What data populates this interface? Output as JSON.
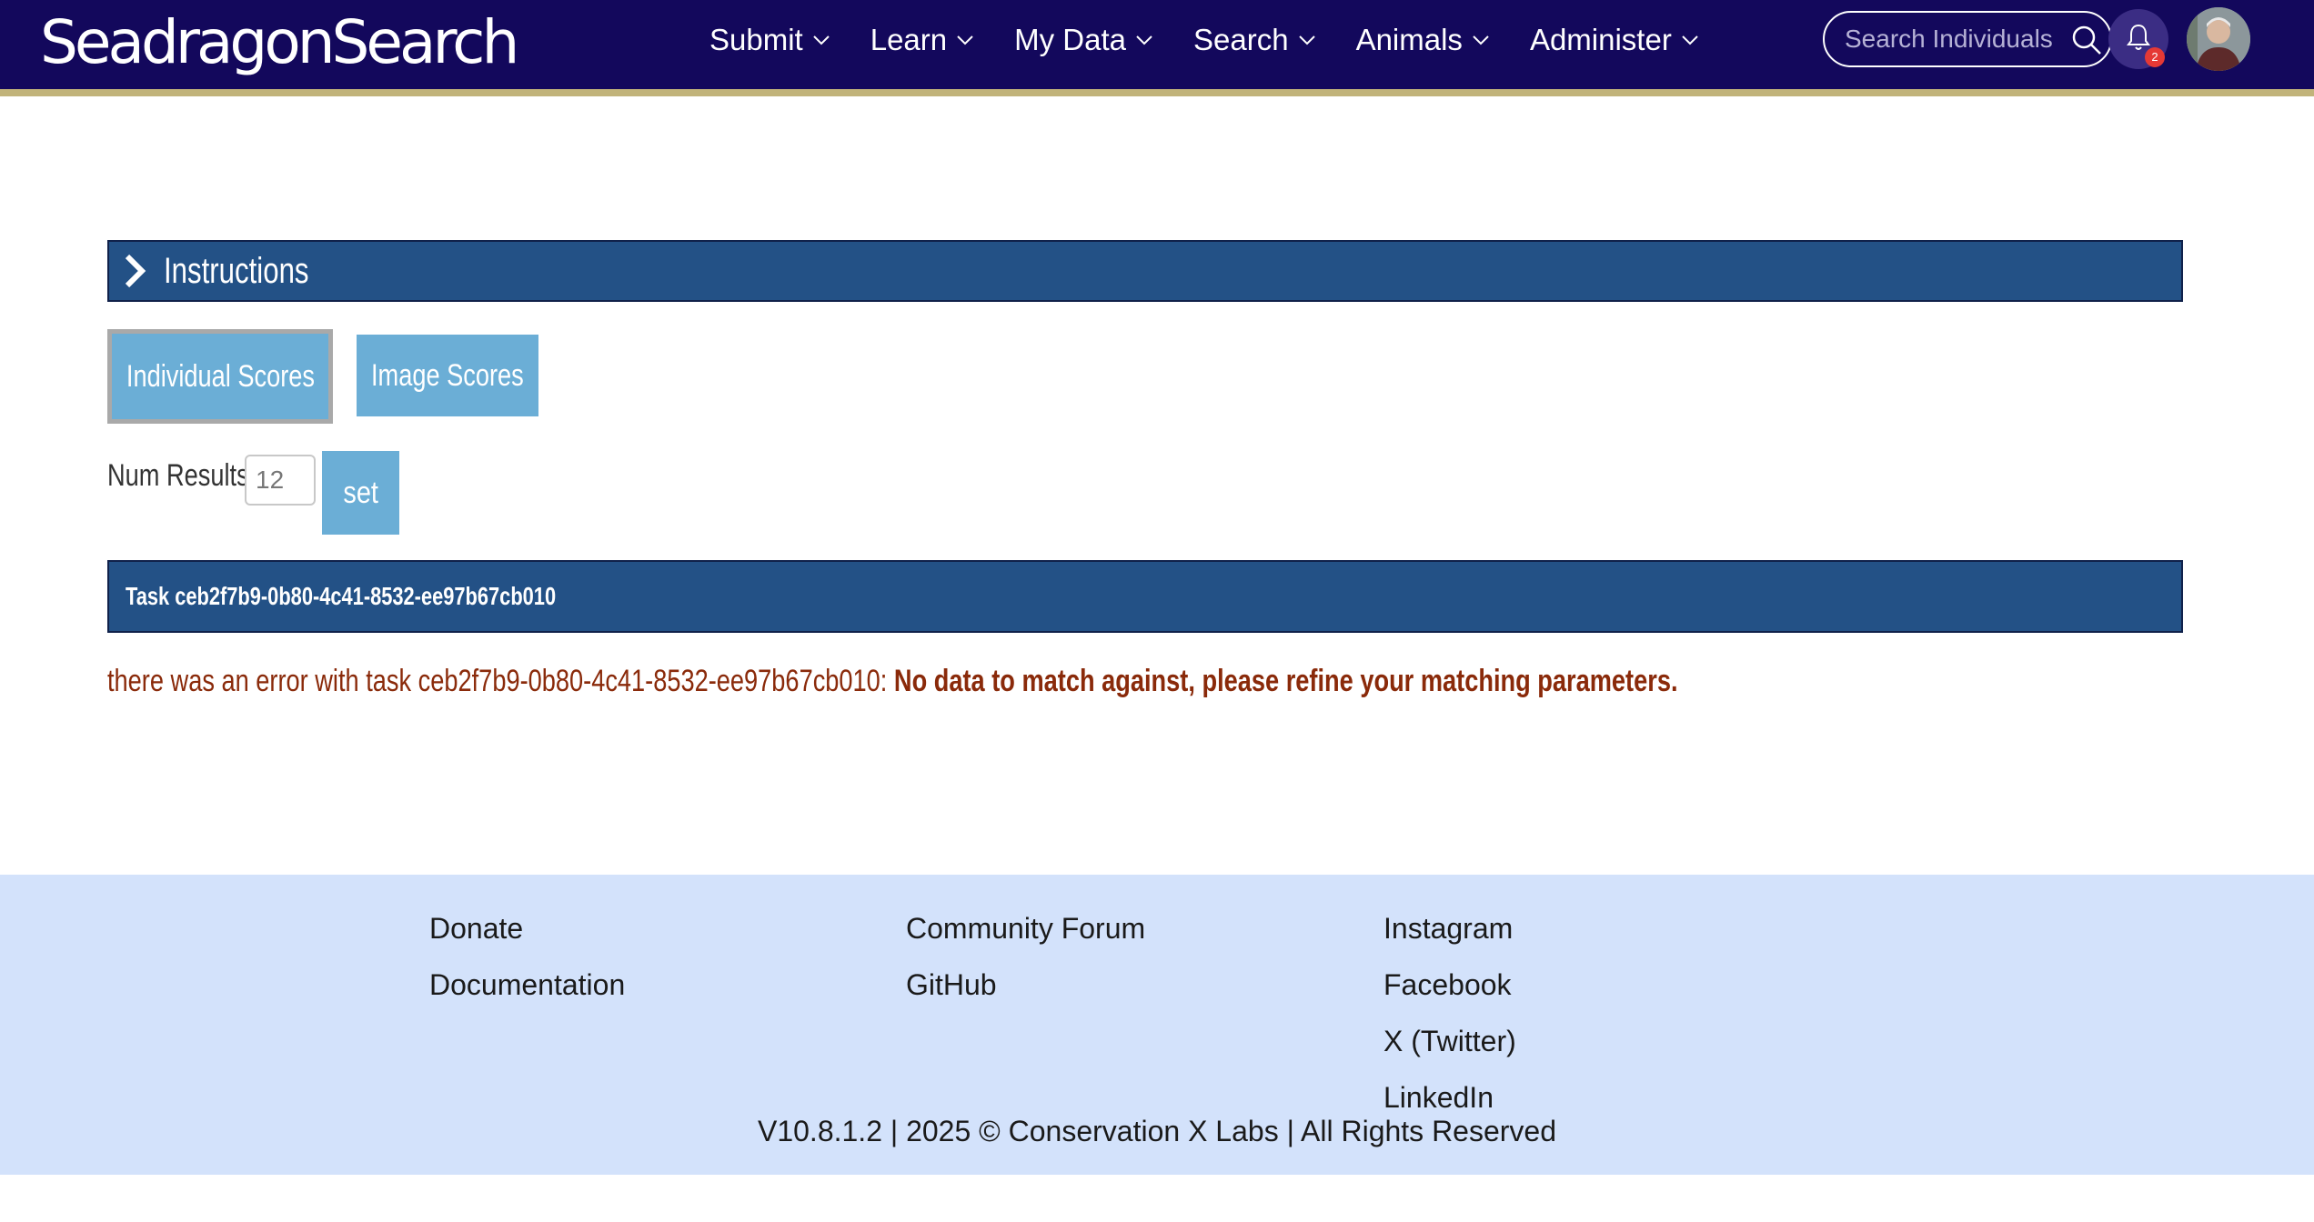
{
  "header": {
    "logo_text": "SeadragonSearch",
    "nav": [
      {
        "label": "Submit"
      },
      {
        "label": "Learn"
      },
      {
        "label": "My Data"
      },
      {
        "label": "Search"
      },
      {
        "label": "Animals"
      },
      {
        "label": "Administer"
      }
    ],
    "search_placeholder": "Search Individuals",
    "notification_count": "2"
  },
  "main": {
    "instructions_title": "Instructions",
    "tabs": [
      {
        "label": "Individual Scores",
        "active": true
      },
      {
        "label": "Image Scores",
        "active": false
      }
    ],
    "num_results_label": "Num Results:",
    "num_results_value": "12",
    "set_label": "set",
    "task_title": "Task ceb2f7b9-0b80-4c41-8532-ee97b67cb010",
    "error_prefix": "there was an error with task ceb2f7b9-0b80-4c41-8532-ee97b67cb010:",
    "error_message": "No data to match against, please refine your matching parameters."
  },
  "footer": {
    "col1": [
      "Donate",
      "Documentation"
    ],
    "col2": [
      "Community Forum",
      "GitHub"
    ],
    "col3": [
      "Instagram",
      "Facebook",
      "X (Twitter)",
      "LinkedIn"
    ],
    "copyright": "V10.8.1.2 | 2025 © Conservation X Labs | All Rights Reserved"
  },
  "colors": {
    "navbar": "#13085c",
    "navbar_border": "#c1b37a",
    "panel": "#235186",
    "button": "#6baed6",
    "error": "#8a2a0a",
    "footer": "#d3e2fb"
  }
}
